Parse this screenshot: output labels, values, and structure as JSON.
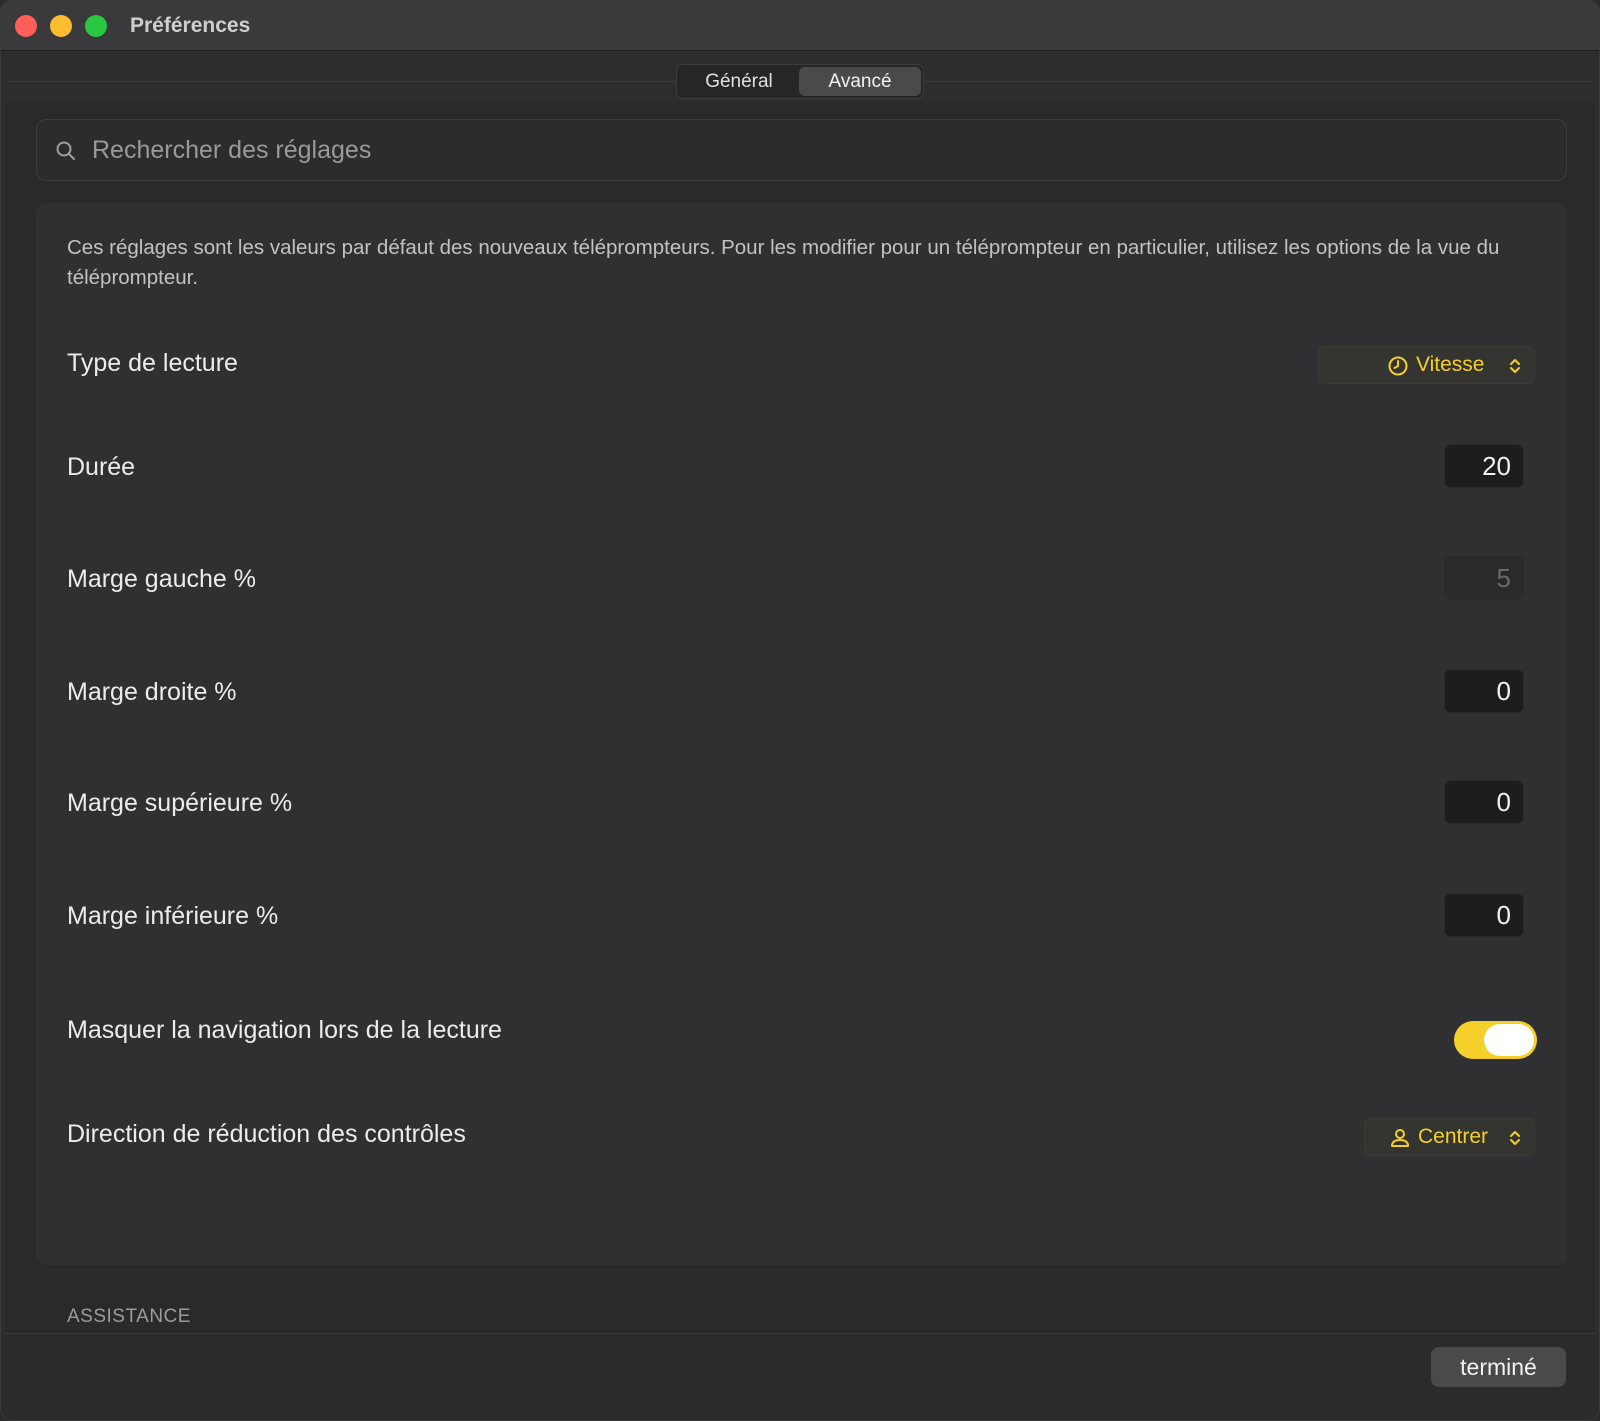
{
  "window": {
    "title": "Préférences"
  },
  "tabs": [
    {
      "label": "Général",
      "selected": false
    },
    {
      "label": "Avancé",
      "selected": true
    }
  ],
  "search": {
    "placeholder": "Rechercher des réglages",
    "value": ""
  },
  "panel": {
    "description": "Ces réglages sont les valeurs par défaut des nouveaux téléprompteurs. Pour les modifier pour un téléprompteur en particulier, utilisez les options de la vue du téléprompteur.",
    "rows": {
      "playback_type": {
        "label": "Type de lecture",
        "value": "Vitesse",
        "icon": "clock-icon"
      },
      "duration": {
        "label": "Durée",
        "value": "20"
      },
      "margin_left": {
        "label": "Marge gauche %",
        "value": "5",
        "disabled": true
      },
      "margin_right": {
        "label": "Marge droite %",
        "value": "0"
      },
      "margin_top": {
        "label": "Marge supérieure %",
        "value": "0"
      },
      "margin_bottom": {
        "label": "Marge inférieure %",
        "value": "0"
      },
      "hide_navigation": {
        "label": "Masquer la navigation lors de la lecture",
        "on": true
      },
      "controls_direction": {
        "label": "Direction de réduction des contrôles",
        "value": "Centrer",
        "icon": "person-center-icon"
      }
    }
  },
  "section_header": "ASSISTANCE",
  "footer": {
    "done_label": "terminé"
  },
  "colors": {
    "accent": "#f5d02a",
    "background": "#2d2d2f",
    "panel": "#303032"
  }
}
